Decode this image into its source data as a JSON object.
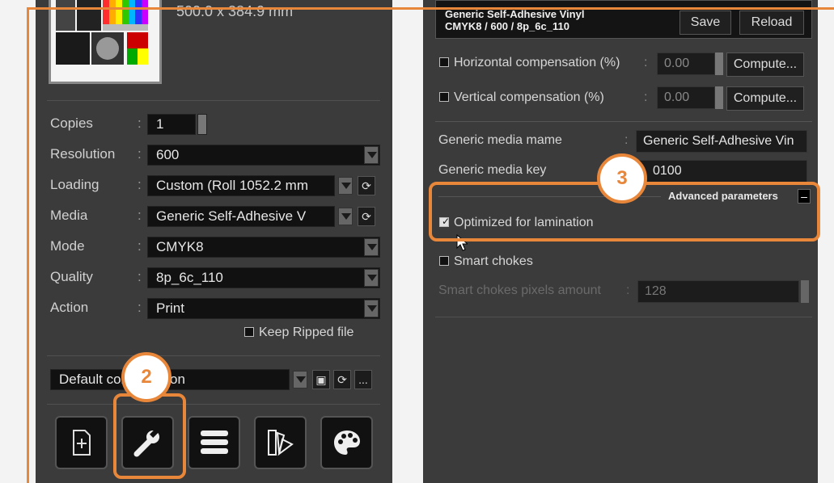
{
  "left": {
    "media_size": "500.0 x 384.9 mm",
    "rows": [
      {
        "label": "Copies",
        "value": "1"
      },
      {
        "label": "Resolution",
        "value": "600"
      },
      {
        "label": "Loading",
        "value": "Custom (Roll 1052.2 mm"
      },
      {
        "label": "Media",
        "value": "Generic Self-Adhesive V"
      },
      {
        "label": "Mode",
        "value": "CMYK8"
      },
      {
        "label": "Quality",
        "value": "8p_6c_110"
      },
      {
        "label": "Action",
        "value": "Print"
      }
    ],
    "colon": ":",
    "keep_ripped": "Keep Ripped file",
    "config_value": "Default configuration",
    "more": "..."
  },
  "right": {
    "header_line1": "Generic Self-Adhesive Vinyl",
    "header_line2": "CMYK8 / 600 / 8p_6c_110",
    "save": "Save",
    "reload": "Reload",
    "horiz_label": "Horizontal compensation (%)",
    "vert_label": "Vertical compensation (%)",
    "horiz_value": "0.00",
    "vert_value": "0.00",
    "compute": "Compute...",
    "media_name_label": "Generic media mame",
    "media_name_value": "Generic Self-Adhesive Vin",
    "media_key_label": "Generic media key",
    "media_key_value": "0100",
    "advanced": "Advanced parameters",
    "collapse": "–",
    "optimized": "Optimized for lamination",
    "smart_chokes": "Smart chokes",
    "smart_pixels_label": "Smart chokes pixels amount",
    "smart_pixels_value": "128",
    "colon": ":"
  },
  "badges": {
    "two": "2",
    "three": "3"
  },
  "colors": {
    "accent": "#e8863a",
    "panel": "#3b3b3b"
  }
}
